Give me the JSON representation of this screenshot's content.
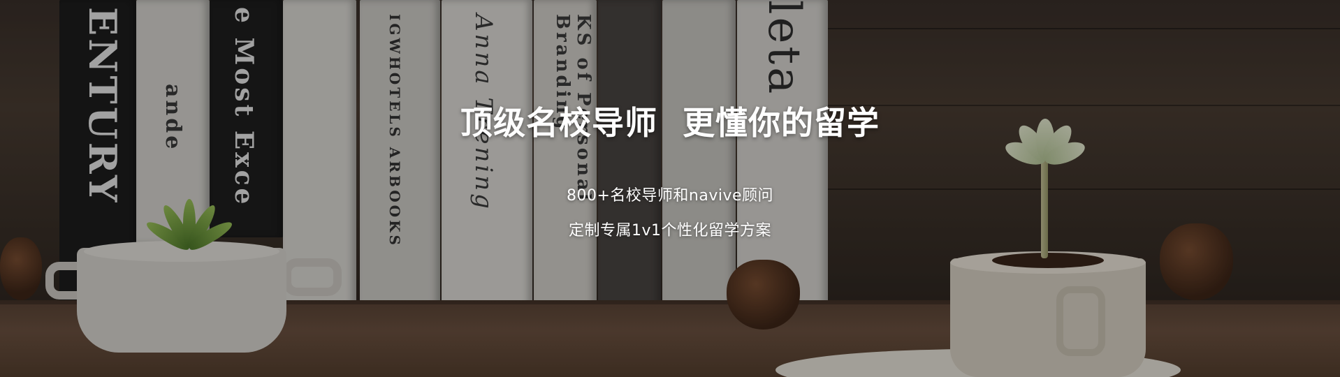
{
  "banner": {
    "headline_part1": "顶级名校导师",
    "headline_part2": "更懂你的留学",
    "subline1": "800+名校导师和navive顾问",
    "subline2": "定制专属1v1个性化留学方案"
  },
  "background": {
    "books": [
      {
        "spine": "ENTURY"
      },
      {
        "spine": "ande"
      },
      {
        "spine": "e Most Exce"
      },
      {
        "spine": ""
      },
      {
        "spine": "IGWHOTELS ARBOOKS"
      },
      {
        "spine": "Anna Trening"
      },
      {
        "spine": "KS of Personal Branding"
      },
      {
        "spine": ""
      },
      {
        "spine": ""
      },
      {
        "spine": "leta"
      }
    ]
  }
}
